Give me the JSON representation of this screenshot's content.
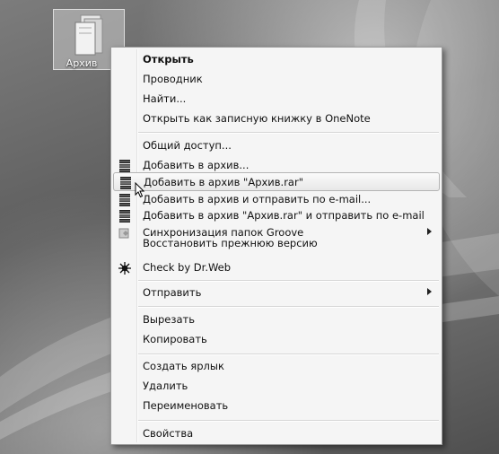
{
  "desktop": {
    "icon_label": "Архив"
  },
  "menu": {
    "open": "Открыть",
    "explorer": "Проводник",
    "find": "Найти...",
    "onenote": "Открыть как записную книжку в OneNote",
    "share": "Общий доступ...",
    "add_archive": "Добавить в архив...",
    "add_archive_rar": "Добавить в архив \"Архив.rar\"",
    "add_archive_email": "Добавить в архив и отправить по e-mail...",
    "add_archive_rar_email": "Добавить в архив \"Архив.rar\" и отправить по e-mail",
    "groove_sync": "Синхронизация папок Groove",
    "restore_previous": "Восстановить прежнюю версию",
    "check_drweb": "Check by Dr.Web",
    "send_to": "Отправить",
    "cut": "Вырезать",
    "copy": "Копировать",
    "create_shortcut": "Создать ярлык",
    "delete": "Удалить",
    "rename": "Переименовать",
    "properties": "Свойства"
  },
  "icons": {
    "folder": "folder-icon",
    "winrar": "winrar-books-icon",
    "groove": "groove-icon",
    "drweb": "drweb-spider-icon",
    "cursor": "mouse-pointer"
  }
}
